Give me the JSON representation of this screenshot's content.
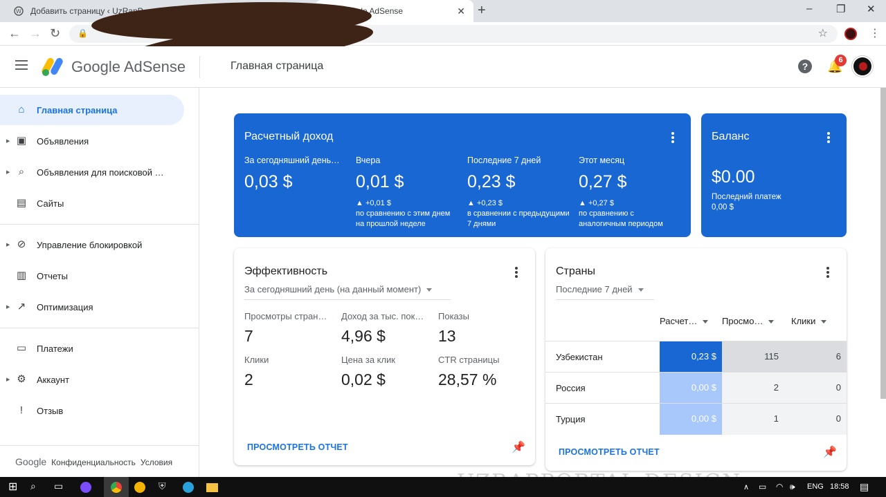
{
  "browser": {
    "tabs": [
      {
        "title": "Добавить страницу ‹ UzRapP…",
        "active": false
      },
      {
        "title": "Google AdSense",
        "active": true
      }
    ],
    "new_tab_label": "+",
    "window_controls": {
      "minimize": "–",
      "maximize": "❐",
      "close": "✕"
    }
  },
  "app": {
    "logo_text": "Google AdSense",
    "page_title": "Главная страница",
    "notifications_count": "6",
    "help_label": "?"
  },
  "sidebar": {
    "items": [
      {
        "label": "Главная страница",
        "icon": "home-icon",
        "active": true,
        "expandable": false
      },
      {
        "label": "Объявления",
        "icon": "ads-icon",
        "expandable": true
      },
      {
        "label": "Объявления для поисковой …",
        "icon": "search-ads-icon",
        "expandable": true
      },
      {
        "label": "Сайты",
        "icon": "sites-icon",
        "expandable": false
      },
      {
        "label": "Управление блокировкой",
        "icon": "block-icon",
        "expandable": true
      },
      {
        "label": "Отчеты",
        "icon": "reports-icon",
        "expandable": false
      },
      {
        "label": "Оптимизация",
        "icon": "optimization-icon",
        "expandable": true
      },
      {
        "label": "Платежи",
        "icon": "payments-icon",
        "expandable": false
      },
      {
        "label": "Аккаунт",
        "icon": "account-icon",
        "expandable": true
      },
      {
        "label": "Отзыв",
        "icon": "feedback-icon",
        "expandable": false
      }
    ],
    "footer": {
      "google": "Google",
      "privacy": "Конфиденциальность",
      "terms": "Условия"
    }
  },
  "estimated": {
    "title": "Расчетный доход",
    "columns": [
      {
        "label": "За сегодняшний день…",
        "value": "0,03 $",
        "delta": "",
        "note": ""
      },
      {
        "label": "Вчера",
        "value": "0,01 $",
        "delta": "▲ +0,01 $",
        "note": "по сравнению с этим днем на прошлой неделе"
      },
      {
        "label": "Последние 7 дней",
        "value": "0,23 $",
        "delta": "▲ +0,23 $",
        "note": "в сравнении с предыдущими 7 днями"
      },
      {
        "label": "Этот месяц",
        "value": "0,27 $",
        "delta": "▲ +0,27 $",
        "note": "по сравнению с аналогичным периодом"
      }
    ]
  },
  "balance": {
    "title": "Баланс",
    "value": "$0.00",
    "last_payment_label": "Последний платеж",
    "last_payment_value": "0,00 $"
  },
  "performance": {
    "title": "Эффективность",
    "period": "За сегодняшний день (на данный момент)",
    "metrics": [
      {
        "label": "Просмотры стран…",
        "value": "7"
      },
      {
        "label": "Доход за тыс. пок…",
        "value": "4,96 $"
      },
      {
        "label": "Показы",
        "value": "13"
      },
      {
        "label": "Клики",
        "value": "2"
      },
      {
        "label": "Цена за клик",
        "value": "0,02 $"
      },
      {
        "label": "CTR страницы",
        "value": "28,57 %"
      }
    ],
    "report_link": "ПРОСМОТРЕТЬ ОТЧЕТ"
  },
  "countries": {
    "title": "Страны",
    "period": "Последние 7 дней",
    "headers": [
      "Расчет…",
      "Просмо…",
      "Клики"
    ],
    "rows": [
      {
        "country": "Узбекистан",
        "earnings": "0,23 $",
        "views": "115",
        "clicks": "6"
      },
      {
        "country": "Россия",
        "earnings": "0,00 $",
        "views": "2",
        "clicks": "0"
      },
      {
        "country": "Турция",
        "earnings": "0,00 $",
        "views": "1",
        "clicks": "0"
      }
    ],
    "report_link": "ПРОСМОТРЕТЬ ОТЧЕТ"
  },
  "taskbar": {
    "lang": "ENG",
    "time": "18:58"
  },
  "watermark": "UZRAPPORTAL DESIGN"
}
